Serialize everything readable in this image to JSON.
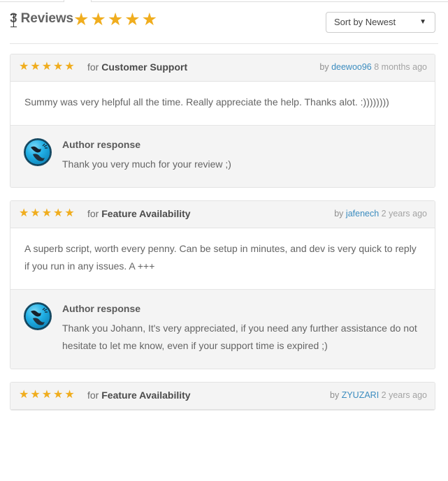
{
  "tabs": [
    {
      "name": "tab-stub-left"
    },
    {
      "name": "tab-stub-right"
    }
  ],
  "header": {
    "title": "3 Reviews",
    "stars": "★★★★★",
    "rating": 5,
    "sort": {
      "selected": "Sort by Newest",
      "arrow": "▼",
      "options": [
        "Sort by Newest"
      ]
    }
  },
  "colors": {
    "star": "#f0ad1e",
    "link": "#3b8cbf",
    "card_header_bg": "#f4f4f4",
    "border": "#e3e3e3",
    "text": "#646464",
    "avatar_blue": "#18a5de"
  },
  "reviews": [
    {
      "stars": "★★★★★",
      "rating": 5,
      "for_prefix": "for ",
      "category": "Customer Support",
      "by_label": "by ",
      "user": "deewoo96",
      "time": "8 months ago",
      "body": "Summy was very helpful all the time. Really appreciate the help. Thanks alot. :))))))))",
      "response": {
        "title": "Author response",
        "text": "Thank you very much for your review ;)",
        "avatar": "bird-avatar-icon"
      }
    },
    {
      "stars": "★★★★★",
      "rating": 5,
      "for_prefix": "for ",
      "category": "Feature Availability",
      "by_label": "by ",
      "user": "jafenech",
      "time": "2 years ago",
      "body": "A superb script, worth every penny. Can be setup in minutes, and dev is very quick to reply if you run in any issues. A +++",
      "response": {
        "title": "Author response",
        "text": "Thank you Johann, It's very appreciated, if you need any further assistance do not hesitate to let me know, even if your support time is expired ;)",
        "avatar": "bird-avatar-icon"
      }
    },
    {
      "stars": "★★★★★",
      "rating": 5,
      "for_prefix": "for ",
      "category": "Feature Availability",
      "by_label": "by ",
      "user": "ZYUZARI",
      "time": "2 years ago",
      "body": "",
      "response": null
    }
  ]
}
